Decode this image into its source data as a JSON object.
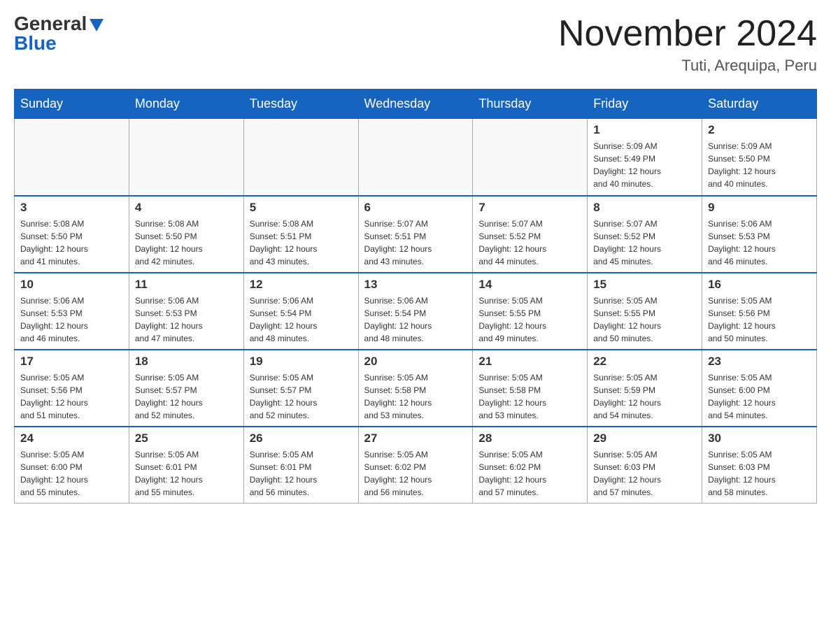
{
  "header": {
    "logo_general": "General",
    "logo_blue": "Blue",
    "month_title": "November 2024",
    "location": "Tuti, Arequipa, Peru"
  },
  "days_of_week": [
    "Sunday",
    "Monday",
    "Tuesday",
    "Wednesday",
    "Thursday",
    "Friday",
    "Saturday"
  ],
  "weeks": [
    [
      {
        "day": "",
        "info": ""
      },
      {
        "day": "",
        "info": ""
      },
      {
        "day": "",
        "info": ""
      },
      {
        "day": "",
        "info": ""
      },
      {
        "day": "",
        "info": ""
      },
      {
        "day": "1",
        "info": "Sunrise: 5:09 AM\nSunset: 5:49 PM\nDaylight: 12 hours\nand 40 minutes."
      },
      {
        "day": "2",
        "info": "Sunrise: 5:09 AM\nSunset: 5:50 PM\nDaylight: 12 hours\nand 40 minutes."
      }
    ],
    [
      {
        "day": "3",
        "info": "Sunrise: 5:08 AM\nSunset: 5:50 PM\nDaylight: 12 hours\nand 41 minutes."
      },
      {
        "day": "4",
        "info": "Sunrise: 5:08 AM\nSunset: 5:50 PM\nDaylight: 12 hours\nand 42 minutes."
      },
      {
        "day": "5",
        "info": "Sunrise: 5:08 AM\nSunset: 5:51 PM\nDaylight: 12 hours\nand 43 minutes."
      },
      {
        "day": "6",
        "info": "Sunrise: 5:07 AM\nSunset: 5:51 PM\nDaylight: 12 hours\nand 43 minutes."
      },
      {
        "day": "7",
        "info": "Sunrise: 5:07 AM\nSunset: 5:52 PM\nDaylight: 12 hours\nand 44 minutes."
      },
      {
        "day": "8",
        "info": "Sunrise: 5:07 AM\nSunset: 5:52 PM\nDaylight: 12 hours\nand 45 minutes."
      },
      {
        "day": "9",
        "info": "Sunrise: 5:06 AM\nSunset: 5:53 PM\nDaylight: 12 hours\nand 46 minutes."
      }
    ],
    [
      {
        "day": "10",
        "info": "Sunrise: 5:06 AM\nSunset: 5:53 PM\nDaylight: 12 hours\nand 46 minutes."
      },
      {
        "day": "11",
        "info": "Sunrise: 5:06 AM\nSunset: 5:53 PM\nDaylight: 12 hours\nand 47 minutes."
      },
      {
        "day": "12",
        "info": "Sunrise: 5:06 AM\nSunset: 5:54 PM\nDaylight: 12 hours\nand 48 minutes."
      },
      {
        "day": "13",
        "info": "Sunrise: 5:06 AM\nSunset: 5:54 PM\nDaylight: 12 hours\nand 48 minutes."
      },
      {
        "day": "14",
        "info": "Sunrise: 5:05 AM\nSunset: 5:55 PM\nDaylight: 12 hours\nand 49 minutes."
      },
      {
        "day": "15",
        "info": "Sunrise: 5:05 AM\nSunset: 5:55 PM\nDaylight: 12 hours\nand 50 minutes."
      },
      {
        "day": "16",
        "info": "Sunrise: 5:05 AM\nSunset: 5:56 PM\nDaylight: 12 hours\nand 50 minutes."
      }
    ],
    [
      {
        "day": "17",
        "info": "Sunrise: 5:05 AM\nSunset: 5:56 PM\nDaylight: 12 hours\nand 51 minutes."
      },
      {
        "day": "18",
        "info": "Sunrise: 5:05 AM\nSunset: 5:57 PM\nDaylight: 12 hours\nand 52 minutes."
      },
      {
        "day": "19",
        "info": "Sunrise: 5:05 AM\nSunset: 5:57 PM\nDaylight: 12 hours\nand 52 minutes."
      },
      {
        "day": "20",
        "info": "Sunrise: 5:05 AM\nSunset: 5:58 PM\nDaylight: 12 hours\nand 53 minutes."
      },
      {
        "day": "21",
        "info": "Sunrise: 5:05 AM\nSunset: 5:58 PM\nDaylight: 12 hours\nand 53 minutes."
      },
      {
        "day": "22",
        "info": "Sunrise: 5:05 AM\nSunset: 5:59 PM\nDaylight: 12 hours\nand 54 minutes."
      },
      {
        "day": "23",
        "info": "Sunrise: 5:05 AM\nSunset: 6:00 PM\nDaylight: 12 hours\nand 54 minutes."
      }
    ],
    [
      {
        "day": "24",
        "info": "Sunrise: 5:05 AM\nSunset: 6:00 PM\nDaylight: 12 hours\nand 55 minutes."
      },
      {
        "day": "25",
        "info": "Sunrise: 5:05 AM\nSunset: 6:01 PM\nDaylight: 12 hours\nand 55 minutes."
      },
      {
        "day": "26",
        "info": "Sunrise: 5:05 AM\nSunset: 6:01 PM\nDaylight: 12 hours\nand 56 minutes."
      },
      {
        "day": "27",
        "info": "Sunrise: 5:05 AM\nSunset: 6:02 PM\nDaylight: 12 hours\nand 56 minutes."
      },
      {
        "day": "28",
        "info": "Sunrise: 5:05 AM\nSunset: 6:02 PM\nDaylight: 12 hours\nand 57 minutes."
      },
      {
        "day": "29",
        "info": "Sunrise: 5:05 AM\nSunset: 6:03 PM\nDaylight: 12 hours\nand 57 minutes."
      },
      {
        "day": "30",
        "info": "Sunrise: 5:05 AM\nSunset: 6:03 PM\nDaylight: 12 hours\nand 58 minutes."
      }
    ]
  ]
}
